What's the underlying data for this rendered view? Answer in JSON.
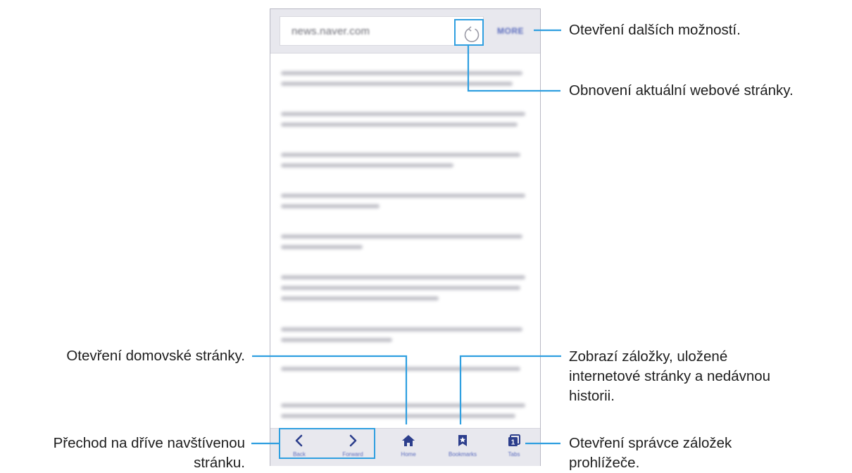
{
  "browser": {
    "url": "news.naver.com",
    "more_label": "MORE",
    "nav_labels": {
      "back": "Back",
      "forward": "Forward",
      "home": "Home",
      "bookmarks": "Bookmarks",
      "tabs": "Tabs"
    },
    "tabs_count": "1"
  },
  "callouts": {
    "more": "Otevření dalších možností.",
    "refresh": "Obnovení aktuální webové stránky.",
    "home": "Otevření domovské stránky.",
    "bookmarks": [
      "Zobrazí záložky, uložené",
      "internetové stránky a nedávnou",
      "historii."
    ],
    "back_forward": [
      "Přechod na dříve navštívenou",
      "stránku."
    ],
    "tabs": [
      "Otevření správce záložek",
      "prohlížeče."
    ]
  },
  "colors": {
    "accent": "#2f9fe0",
    "icon": "#2c3e8c",
    "bar": "#e8e8ee"
  }
}
